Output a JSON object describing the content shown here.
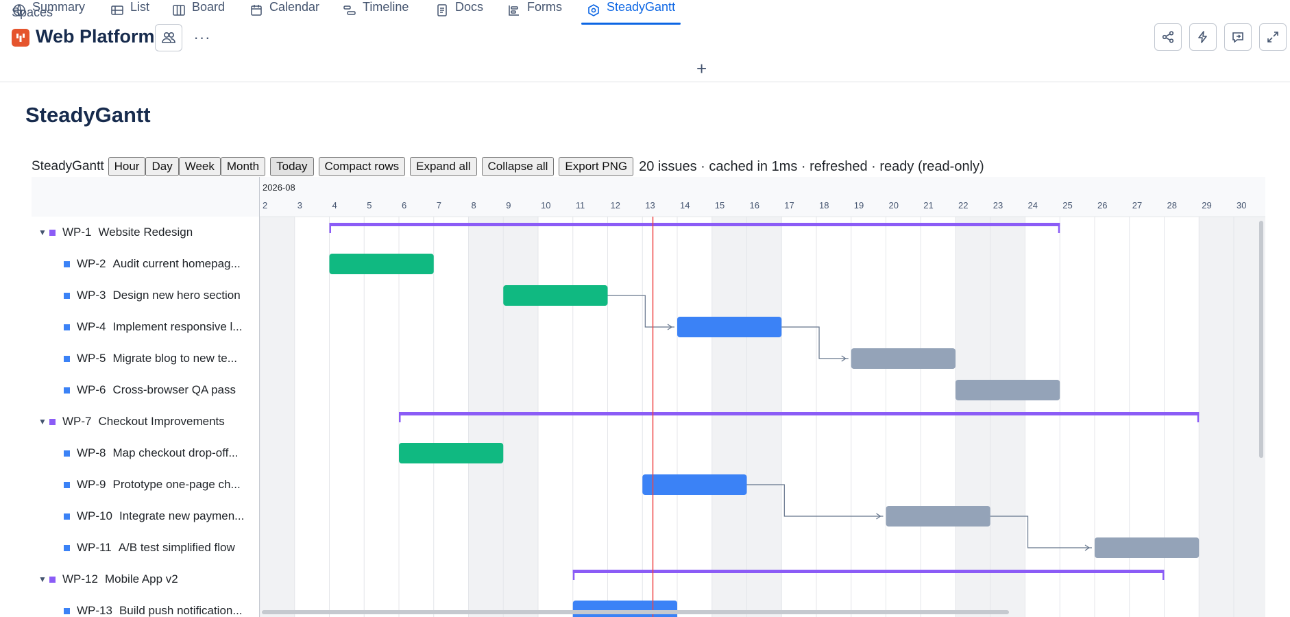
{
  "header": {
    "breadcrumb": "Spaces",
    "title": "Web Platform",
    "more": "···"
  },
  "tabs": [
    {
      "label": "Summary",
      "icon": "globe-icon"
    },
    {
      "label": "List",
      "icon": "list-icon"
    },
    {
      "label": "Board",
      "icon": "board-icon"
    },
    {
      "label": "Calendar",
      "icon": "calendar-icon"
    },
    {
      "label": "Timeline",
      "icon": "timeline-icon"
    },
    {
      "label": "Docs",
      "icon": "docs-icon"
    },
    {
      "label": "Forms",
      "icon": "forms-icon"
    },
    {
      "label": "SteadyGantt",
      "icon": "app-icon",
      "active": true
    }
  ],
  "page": {
    "heading": "SteadyGantt"
  },
  "toolbar": {
    "label": "SteadyGantt",
    "buttons": [
      "Hour",
      "Day",
      "Week",
      "Month",
      "Today",
      "Compact rows",
      "Expand all",
      "Collapse all",
      "Export PNG"
    ],
    "status": "20 issues · cached in 1ms · refreshed · ready (read-only)"
  },
  "gantt": {
    "month_label": "2026-08",
    "days": [
      "2",
      "3",
      "4",
      "5",
      "6",
      "7",
      "8",
      "9",
      "10",
      "11",
      "12",
      "13",
      "14",
      "15",
      "16",
      "17",
      "18",
      "19",
      "20",
      "21",
      "22",
      "23",
      "24",
      "25",
      "26",
      "27",
      "28",
      "29",
      "30"
    ],
    "weekend_days": [
      2,
      8,
      9,
      15,
      16,
      22,
      23,
      29,
      30
    ],
    "today": 13.3,
    "colors": {
      "epic": "#8b5cf6",
      "done": "#10b981",
      "in_progress": "#3b82f6",
      "todo": "#94a3b8",
      "today": "#ef4444",
      "task_square": "#3b82f6",
      "epic_square": "#8b5cf6"
    },
    "rows": [
      {
        "id": "WP-1",
        "name": "Website Redesign",
        "type": "epic",
        "start": 4,
        "end": 25
      },
      {
        "id": "WP-2",
        "name": "Audit current homepag...",
        "type": "task",
        "status": "done",
        "start": 4,
        "end": 7
      },
      {
        "id": "WP-3",
        "name": "Design new hero section",
        "type": "task",
        "status": "done",
        "start": 9,
        "end": 12
      },
      {
        "id": "WP-4",
        "name": "Implement responsive l...",
        "type": "task",
        "status": "in_progress",
        "start": 14,
        "end": 17
      },
      {
        "id": "WP-5",
        "name": "Migrate blog to new te...",
        "type": "task",
        "status": "todo",
        "start": 19,
        "end": 22
      },
      {
        "id": "WP-6",
        "name": "Cross-browser QA pass",
        "type": "task",
        "status": "todo",
        "start": 22,
        "end": 25
      },
      {
        "id": "WP-7",
        "name": "Checkout Improvements",
        "type": "epic",
        "start": 6,
        "end": 29
      },
      {
        "id": "WP-8",
        "name": "Map checkout drop-off...",
        "type": "task",
        "status": "done",
        "start": 6,
        "end": 9
      },
      {
        "id": "WP-9",
        "name": "Prototype one-page ch...",
        "type": "task",
        "status": "in_progress",
        "start": 13,
        "end": 16
      },
      {
        "id": "WP-10",
        "name": "Integrate new paymen...",
        "type": "task",
        "status": "todo",
        "start": 20,
        "end": 23
      },
      {
        "id": "WP-11",
        "name": "A/B test simplified flow",
        "type": "task",
        "status": "todo",
        "start": 26,
        "end": 29
      },
      {
        "id": "WP-12",
        "name": "Mobile App v2",
        "type": "epic",
        "start": 11,
        "end": 28
      },
      {
        "id": "WP-13",
        "name": "Build push notification...",
        "type": "task",
        "status": "in_progress",
        "start": 11,
        "end": 14
      }
    ],
    "dependencies": [
      {
        "from": "WP-3",
        "to": "WP-4"
      },
      {
        "from": "WP-4",
        "to": "WP-5"
      },
      {
        "from": "WP-9",
        "to": "WP-10"
      },
      {
        "from": "WP-10",
        "to": "WP-11"
      }
    ]
  }
}
